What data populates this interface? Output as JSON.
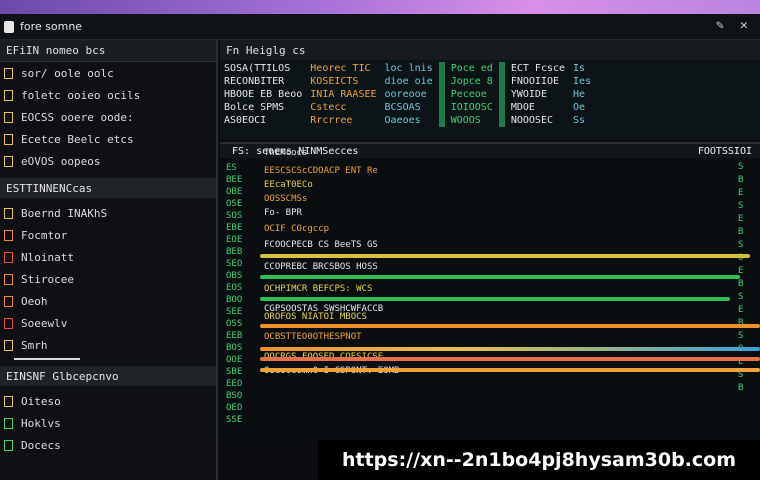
{
  "window": {
    "title": "fore somne",
    "controls": [
      "✎",
      "✕"
    ]
  },
  "sidebar": {
    "header": "EFiIN nomeo bcs",
    "items": [
      {
        "label": "sor/ oole oolc",
        "color": "y"
      },
      {
        "label": "foletc ooieo ocils",
        "color": "y"
      },
      {
        "label": "EOCSS ooere oode:",
        "color": "y"
      },
      {
        "label": "Ecetce Beelc etcs",
        "color": "y"
      },
      {
        "label": "eOVOS oopeos",
        "color": "y"
      }
    ],
    "section1": "ESTTINNENCcas",
    "items2": [
      {
        "label": "Boernd INAKhS",
        "color": "y"
      },
      {
        "label": "Focmtor",
        "color": "o"
      },
      {
        "label": "Nloinatt",
        "color": "r"
      },
      {
        "label": "Stirocee",
        "color": "o"
      },
      {
        "label": "Oeoh",
        "color": "o"
      },
      {
        "label": "Soeewlv",
        "color": "r"
      },
      {
        "label": "Smrh",
        "color": "y"
      }
    ],
    "section2": "EINSNF Glbcepcnvo",
    "items3": [
      {
        "label": "Oiteso",
        "color": "y"
      },
      {
        "label": "Hoklvs",
        "color": "g"
      },
      {
        "label": "Docecs",
        "color": "g"
      }
    ]
  },
  "topgrid": {
    "header": "Fn Heiglg cs",
    "col1": [
      "SOSA(TTILOS",
      "RECONBITER",
      "HBOOE EB Beoo",
      "Bolce SPMS",
      "AS0EOCI"
    ],
    "col2": [
      "Heorec TIC",
      "KOSEICTS",
      "INIA RAASEE",
      "Cstecc",
      "Rrcrree"
    ],
    "col3": [
      "loc lnis",
      "dioe oie",
      "ooreooe",
      "BCSOAS",
      "Oaeoes"
    ],
    "col4": [
      "Poce ed",
      "Jopce 8",
      "Peceoe",
      "IOIOOSC",
      "WOOOS"
    ],
    "col5": [
      "ECT Fcsce",
      "FNOOIIOE",
      "YWOIDE",
      "MDOE",
      "NOOOSEC"
    ],
    "col6": [
      "Is",
      "Ies",
      "He",
      "Oe",
      "Ss"
    ]
  },
  "codepanel": {
    "header": "FS: seoecs NINMSecces",
    "header_right": "FOOTSSIOI",
    "lines": [
      "ThEMcocs",
      "EESCSCScCDOACP ENT Re",
      "EEcaT0ECo",
      "OOSSCMSs",
      "Fo- BPR",
      "OCIF COcgccp",
      "FCOOCPECB CS BeeTS GS",
      "CCOPREBC BRCSBOS HOSS",
      "OCHPIMCR BEFCPS: WCS",
      "CGPSOOSTAS SWSHCWFACCB",
      "OROFOS NIATOI MBOCS",
      "OCBSTTEO0OTHESPNOT",
      "OOCRGS FOOSED COESICSE",
      "Oeeoceomn0 I CSPONT: EOMB"
    ],
    "gutter": [
      "ES",
      "BEE",
      "OBE",
      "OSE",
      "SOS",
      "EBE",
      "EOE",
      "BEB",
      "SEO",
      "OBS",
      "EOS",
      "BOO",
      "SEE",
      "OSS",
      "EEB",
      "BOS",
      "OOE",
      "SBE",
      "EEO",
      "BSO",
      "OEO",
      "SSE"
    ],
    "rgutter": [
      "S",
      "B",
      "E",
      "S",
      "E",
      "B",
      "S",
      "O",
      "E",
      "B",
      "S",
      "E",
      "B",
      "S",
      "O",
      "E",
      "S",
      "B"
    ]
  },
  "url_badge": "https://xn--2n1bo4pj8hysam30b.com",
  "colors": {
    "accent_green": "#3fd26a",
    "accent_orange": "#f0a13a",
    "accent_yellow": "#e8d24a"
  }
}
